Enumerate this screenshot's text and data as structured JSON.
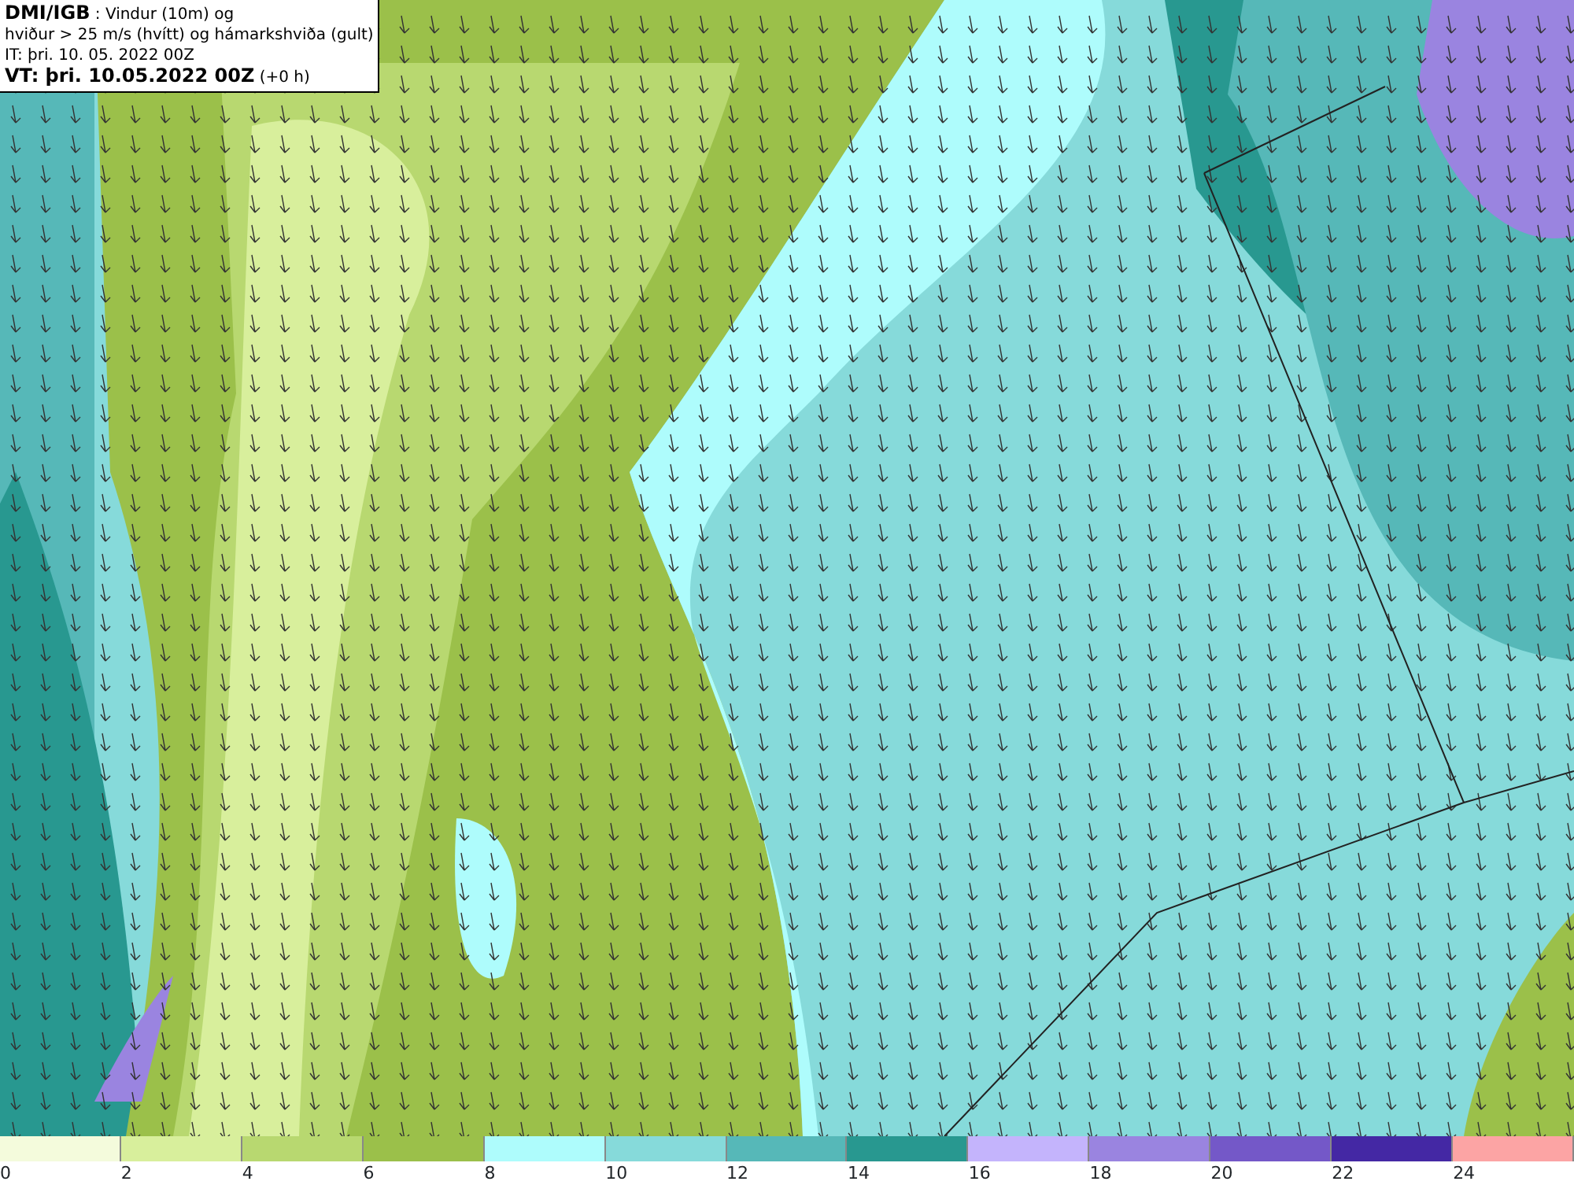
{
  "title_box": {
    "lines": [
      "**DMI/IGB** : Vindur (10m) og",
      "hviður > 25 m/s (hvítt) og hámarkshviða (gult)",
      "IT: þri. 10. 05. 2022 00Z",
      "**VT: þri. 10.05.2022 00Z** (+0 h)"
    ]
  },
  "legend": {
    "bins": [
      {
        "color": "#f4fbdc",
        "label": "0"
      },
      {
        "color": "#d8ef9c",
        "label": "2"
      },
      {
        "color": "#b8d870",
        "label": "4"
      },
      {
        "color": "#9bc04a",
        "label": "6"
      },
      {
        "color": "#aefcfc",
        "label": "8"
      },
      {
        "color": "#86dada",
        "label": "10"
      },
      {
        "color": "#56b8b8",
        "label": "12"
      },
      {
        "color": "#289890",
        "label": "14"
      },
      {
        "color": "#c4b4fc",
        "label": "16"
      },
      {
        "color": "#9a84e0",
        "label": "18"
      },
      {
        "color": "#7458c8",
        "label": "20"
      },
      {
        "color": "#4428a4",
        "label": "22"
      },
      {
        "color": "#fca4a4",
        "label": "24"
      }
    ]
  }
}
